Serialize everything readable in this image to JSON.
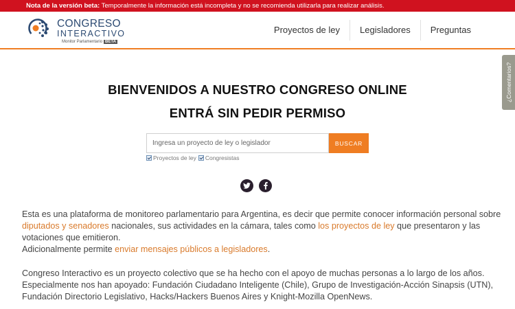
{
  "beta_bar": {
    "label": "Nota de la versión beta:",
    "message": "Temporalmente la información está incompleta y no se recomienda utilizarla para realizar análisis."
  },
  "logo": {
    "title": "CONGRESO",
    "subtitle": "INTERACTIVO",
    "tagline": "Monitor Parlamentario",
    "badge": "BETA"
  },
  "nav": {
    "items": [
      "Proyectos de ley",
      "Legisladores",
      "Preguntas"
    ]
  },
  "hero": {
    "line1": "BIENVENIDOS A NUESTRO CONGRESO ONLINE",
    "line2": "ENTRÁ SIN PEDIR PERMISO"
  },
  "search": {
    "value": "",
    "placeholder": "Ingresa un proyecto de ley o legislador",
    "button_label": "BUSCAR",
    "filters": [
      {
        "label": "Proyectos de ley",
        "checked": true
      },
      {
        "label": "Congresistas",
        "checked": true
      }
    ]
  },
  "social": [
    "twitter-icon",
    "facebook-icon"
  ],
  "intro": {
    "l1": "Esta es una plataforma de monitoreo parlamentario para Argentina, es decir que permite conocer información personal sobre",
    "l2_link1": "diputados y senadores",
    "l2_mid": " nacionales, sus actividades en la cámara, tales como ",
    "l2_link2": "los proyectos de ley",
    "l2_end": " que presentaron y las",
    "l3": "votaciones que emitieron.",
    "l4_pre": "Adicionalmente permite ",
    "l4_link": "enviar mensajes públicos a legisladores",
    "l4_post": "."
  },
  "about": {
    "l1": "Congreso Interactivo es un proyecto colectivo que se ha hecho con el apoyo de muchas personas a lo largo de los años.",
    "l2": "Especialmente nos han apoyado: Fundación Ciudadano Inteligente (Chile), Grupo de Investigación-Acción Sinapsis (UTN),",
    "l3": "Fundación Directorio Legislativo, Hacks/Hackers Buenos Aires y Knight-Mozilla OpenNews."
  },
  "feedback_tab": "¿Comentarios?",
  "colors": {
    "beta_bar": "#d0121f",
    "accent": "#ef7d22",
    "link": "#d97a2b",
    "logo_blue": "#2c4a72"
  }
}
